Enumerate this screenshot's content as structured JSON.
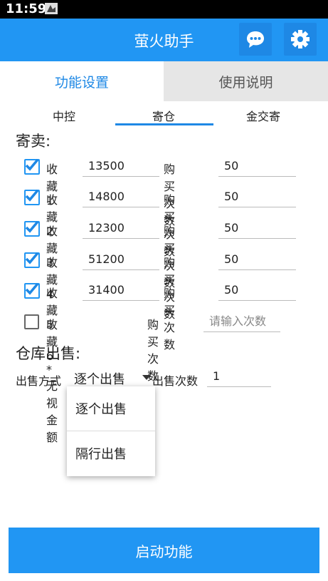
{
  "status": {
    "time": "11:59"
  },
  "app": {
    "title": "萤火助手",
    "chat_icon": "chat-bubble-icon",
    "settings_icon": "gear-icon",
    "accent": "#2196F3"
  },
  "main_tabs": [
    {
      "label": "功能设置",
      "active": true
    },
    {
      "label": "使用说明",
      "active": false
    }
  ],
  "sub_tabs": [
    {
      "label": "中控",
      "active": false
    },
    {
      "label": "寄仓",
      "active": true
    },
    {
      "label": "金交寄",
      "active": false
    }
  ],
  "consign": {
    "title": "寄卖:",
    "qty_label": "购买次数",
    "rows": [
      {
        "label": "收藏1",
        "checked": true,
        "price": "13500",
        "qty": "50"
      },
      {
        "label": "收藏2",
        "checked": true,
        "price": "14800",
        "qty": "50"
      },
      {
        "label": "收藏3",
        "checked": true,
        "price": "12300",
        "qty": "50"
      },
      {
        "label": "收藏4",
        "checked": true,
        "price": "51200",
        "qty": "50"
      },
      {
        "label": "收藏5",
        "checked": true,
        "price": "31400",
        "qty": "50"
      }
    ],
    "row6": {
      "label": "收藏6 *无视金额",
      "checked": false,
      "qty_label": "购买次数",
      "qty_placeholder": "请输入次数"
    }
  },
  "warehouse": {
    "title": "仓库出售:",
    "mode_label": "出售方式",
    "mode_selected": "逐个出售",
    "count_label": "出售次数",
    "count_value": "1",
    "options": [
      "逐个出售",
      "隔行出售"
    ]
  },
  "start_button": "启动功能"
}
